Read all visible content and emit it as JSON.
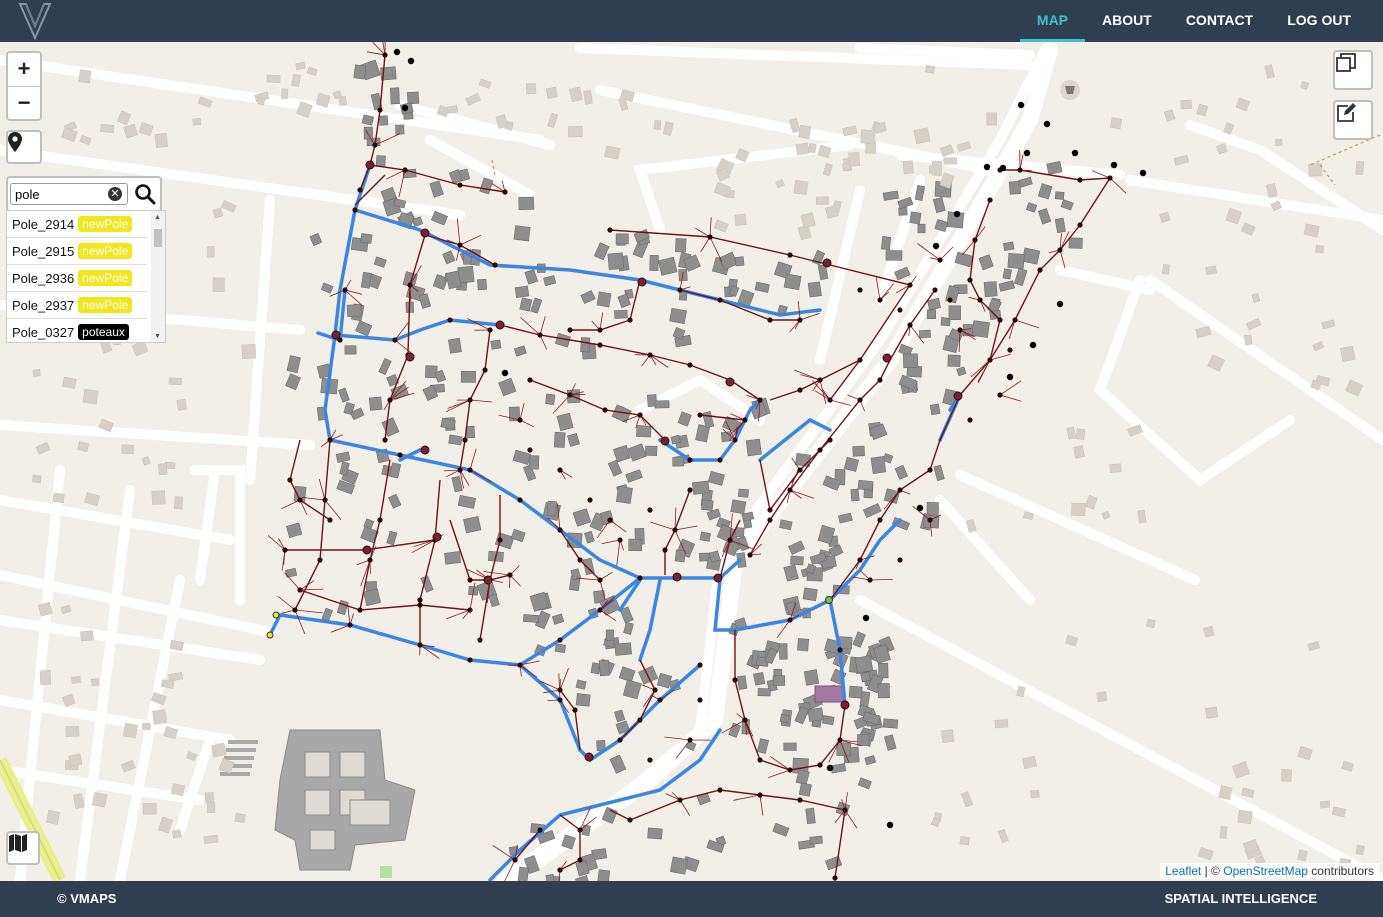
{
  "nav": {
    "items": [
      {
        "label": "MAP",
        "active": true
      },
      {
        "label": "ABOUT",
        "active": false
      },
      {
        "label": "CONTACT",
        "active": false
      },
      {
        "label": "LOG OUT",
        "active": false
      }
    ]
  },
  "map_controls": {
    "zoom_in": "+",
    "zoom_out": "−"
  },
  "search": {
    "value": "pole"
  },
  "results": [
    {
      "name": "Pole_2914",
      "tag": "newPole",
      "tag_color": "#f2e61c"
    },
    {
      "name": "Pole_2915",
      "tag": "newPole",
      "tag_color": "#f2e61c"
    },
    {
      "name": "Pole_2936",
      "tag": "newPole",
      "tag_color": "#f2e61c"
    },
    {
      "name": "Pole_2937",
      "tag": "newPole",
      "tag_color": "#f2e61c"
    },
    {
      "name": "Pole_0327",
      "tag": "poteaux",
      "tag_color": "#000000"
    }
  ],
  "attribution": {
    "leaflet": "Leaflet",
    "separator": "| ©",
    "osm": "OpenStreetMap",
    "suffix": "contributors"
  },
  "footer": {
    "left": "© VMAPS",
    "right": "SPATIAL INTELLIGENCE"
  },
  "colors": {
    "header_bg": "#2f3e50",
    "active_nav": "#3fc1c9",
    "network_blue": "#3a86e0",
    "network_red": "#7a1010"
  }
}
